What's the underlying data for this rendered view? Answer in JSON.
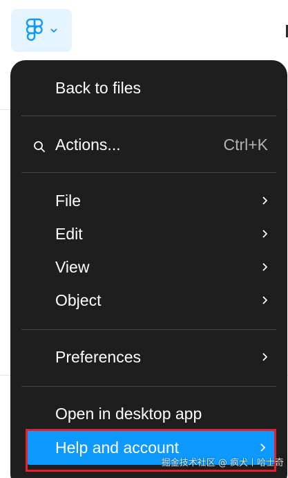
{
  "colors": {
    "menu_background": "#1e1e1e",
    "highlight": "#0d99ff",
    "trigger_background": "#e5f4ff",
    "annotation_border": "#e5202a",
    "shortcut_text": "#b3b3b3"
  },
  "trigger": {
    "icon": "figma-logo-icon",
    "chevron_icon": "chevron-down-icon"
  },
  "menu": {
    "back_to_files": "Back to files",
    "actions": {
      "label": "Actions...",
      "shortcut": "Ctrl+K",
      "icon": "search-icon"
    },
    "file": "File",
    "edit": "Edit",
    "view": "View",
    "object": "Object",
    "preferences": "Preferences",
    "open_desktop": "Open in desktop app",
    "help_account": "Help and account",
    "submenu_icon": "chevron-right-icon"
  },
  "watermark": "掘金技术社区 @ 疯犬丨哈士奇"
}
